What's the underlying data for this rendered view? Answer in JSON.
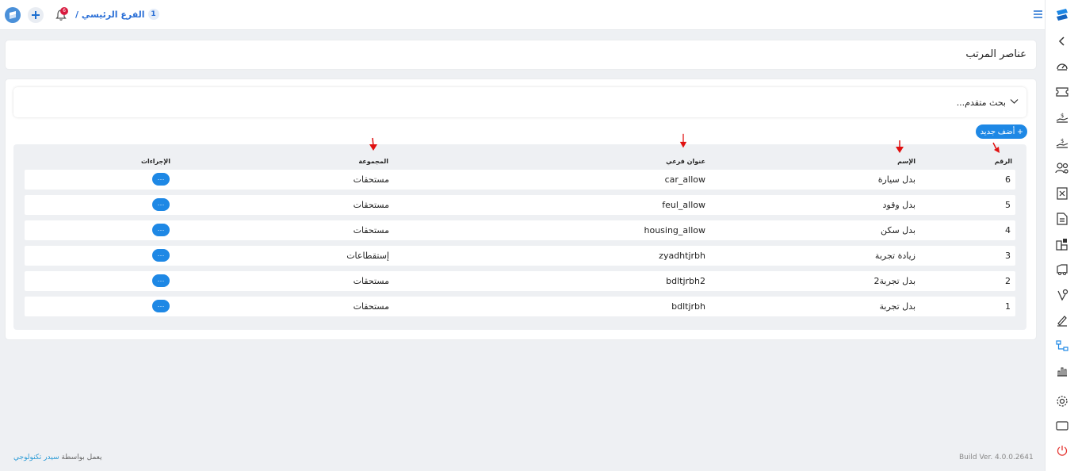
{
  "topbar": {
    "notification_count": "6",
    "branch_number": "1",
    "branch_label": "الفرع الرئيسي /"
  },
  "page": {
    "title": "عناصر المرتب"
  },
  "search": {
    "label": "بحث متقدم..."
  },
  "toolbar": {
    "add_label": "أضف جديد"
  },
  "table": {
    "columns": {
      "number": "الرقم",
      "name": "الإسم",
      "subtitle": "عنوان فرعي",
      "group": "المجموعة",
      "actions": "الإجراءات"
    },
    "rows": [
      {
        "number": "6",
        "name": "بدل سيارة",
        "subtitle": "car_allow",
        "group": "مستحقات",
        "action": "···"
      },
      {
        "number": "5",
        "name": "بدل وقود",
        "subtitle": "feul_allow",
        "group": "مستحقات",
        "action": "···"
      },
      {
        "number": "4",
        "name": "بدل سكن",
        "subtitle": "housing_allow",
        "group": "مستحقات",
        "action": "···"
      },
      {
        "number": "3",
        "name": "زيادة تجربة",
        "subtitle": "zyadhtjrbh",
        "group": "إستقطاعات",
        "action": "···"
      },
      {
        "number": "2",
        "name": "بدل تجربة2",
        "subtitle": "bdltjrbh2",
        "group": "مستحقات",
        "action": "···"
      },
      {
        "number": "1",
        "name": "بدل تجربة",
        "subtitle": "bdltjrbh",
        "group": "مستحقات",
        "action": "···"
      }
    ]
  },
  "footer": {
    "powered_prefix": "يعمل بواسطة",
    "powered_link": "سيدر تكنولوجي",
    "build": "Build Ver. 4.0.0.2641"
  },
  "colors": {
    "accent": "#1e88e5",
    "badge": "#d81b3f",
    "arrow": "#e01010",
    "power": "#e53935"
  }
}
